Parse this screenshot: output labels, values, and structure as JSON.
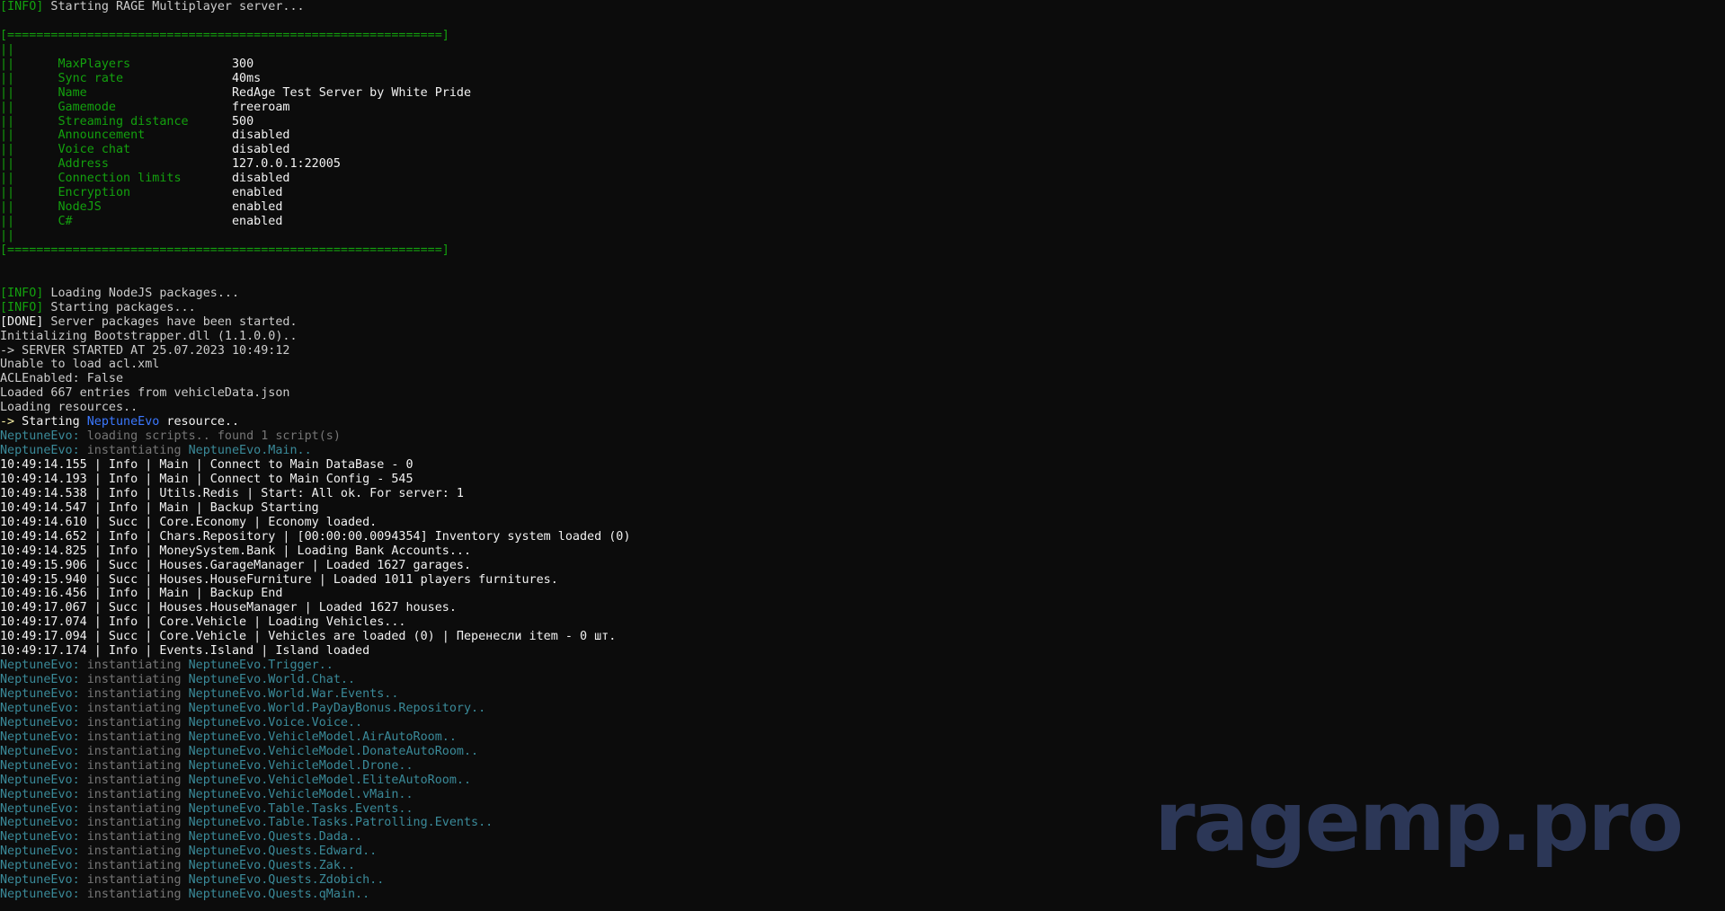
{
  "colors": {
    "default": "#cccccc",
    "green": "#13a10e",
    "bright_green": "#16c60c",
    "white": "#f2f2f2",
    "yellow": "#f9f1a5",
    "blue": "#3b78ff",
    "teal": "#3a96dd",
    "gray": "#767676",
    "dark_cyan": "#3a8a99",
    "watermark": "#2e3a5c",
    "background": "#0c0c0c"
  },
  "watermark": {
    "text": "ragemp.pro"
  },
  "console": {
    "lines": [
      [
        {
          "c": "green",
          "t": "[INFO]"
        },
        {
          "c": "default",
          "t": " Starting RAGE Multiplayer server..."
        }
      ],
      [],
      [
        {
          "c": "green",
          "t": "[============================================================]"
        }
      ],
      [
        {
          "c": "green",
          "t": "||"
        }
      ],
      [
        {
          "c": "green",
          "t": "||      MaxPlayers              "
        },
        {
          "c": "white",
          "t": "300"
        }
      ],
      [
        {
          "c": "green",
          "t": "||      Sync rate               "
        },
        {
          "c": "white",
          "t": "40ms"
        }
      ],
      [
        {
          "c": "green",
          "t": "||      Name                    "
        },
        {
          "c": "white",
          "t": "RedAge Test Server by White Pride"
        }
      ],
      [
        {
          "c": "green",
          "t": "||      Gamemode                "
        },
        {
          "c": "white",
          "t": "freeroam"
        }
      ],
      [
        {
          "c": "green",
          "t": "||      Streaming distance      "
        },
        {
          "c": "white",
          "t": "500"
        }
      ],
      [
        {
          "c": "green",
          "t": "||      Announcement            "
        },
        {
          "c": "white",
          "t": "disabled"
        }
      ],
      [
        {
          "c": "green",
          "t": "||      Voice chat              "
        },
        {
          "c": "white",
          "t": "disabled"
        }
      ],
      [
        {
          "c": "green",
          "t": "||      Address                 "
        },
        {
          "c": "white",
          "t": "127.0.0.1:22005"
        }
      ],
      [
        {
          "c": "green",
          "t": "||      Connection limits       "
        },
        {
          "c": "white",
          "t": "disabled"
        }
      ],
      [
        {
          "c": "green",
          "t": "||      Encryption              "
        },
        {
          "c": "white",
          "t": "enabled"
        }
      ],
      [
        {
          "c": "green",
          "t": "||      NodeJS                  "
        },
        {
          "c": "white",
          "t": "enabled"
        }
      ],
      [
        {
          "c": "green",
          "t": "||      C#                      "
        },
        {
          "c": "white",
          "t": "enabled"
        }
      ],
      [
        {
          "c": "green",
          "t": "||"
        }
      ],
      [
        {
          "c": "green",
          "t": "[============================================================]"
        }
      ],
      [],
      [],
      [
        {
          "c": "green",
          "t": "[INFO]"
        },
        {
          "c": "default",
          "t": " Loading NodeJS packages..."
        }
      ],
      [
        {
          "c": "green",
          "t": "[INFO]"
        },
        {
          "c": "default",
          "t": " Starting packages..."
        }
      ],
      [
        {
          "c": "white",
          "t": "[DONE]"
        },
        {
          "c": "default",
          "t": " Server packages have been started."
        }
      ],
      [
        {
          "c": "default",
          "t": "Initializing Bootstrapper.dll (1.1.0.0).."
        }
      ],
      [
        {
          "c": "default",
          "t": "-> SERVER STARTED AT 25.07.2023 10:49:12"
        }
      ],
      [
        {
          "c": "default",
          "t": "Unable to load acl.xml"
        }
      ],
      [
        {
          "c": "default",
          "t": "ACLEnabled: False"
        }
      ],
      [
        {
          "c": "default",
          "t": "Loaded 667 entries from vehicleData.json"
        }
      ],
      [
        {
          "c": "default",
          "t": "Loading resources.."
        }
      ],
      [
        {
          "c": "yellow",
          "t": "->"
        },
        {
          "c": "white",
          "t": " Starting "
        },
        {
          "c": "blue",
          "t": "NeptuneEvo"
        },
        {
          "c": "white",
          "t": " resource.."
        }
      ],
      [
        {
          "c": "dkcyan",
          "t": "NeptuneEvo: "
        },
        {
          "c": "gray",
          "t": "loading scripts.. found 1 script(s)"
        }
      ],
      [
        {
          "c": "dkcyan",
          "t": "NeptuneEvo: "
        },
        {
          "c": "gray",
          "t": "instantiating "
        },
        {
          "c": "dkcyan",
          "t": "NeptuneEvo.Main.."
        }
      ],
      [
        {
          "c": "white",
          "t": "10:49:14.155 | Info | Main | Connect to Main DataBase - 0"
        }
      ],
      [
        {
          "c": "white",
          "t": "10:49:14.193 | Info | Main | Connect to Main Config - 545"
        }
      ],
      [
        {
          "c": "white",
          "t": "10:49:14.538 | Info | Utils.Redis | Start: All ok. For server: 1"
        }
      ],
      [
        {
          "c": "white",
          "t": "10:49:14.547 | Info | Main | Backup Starting"
        }
      ],
      [
        {
          "c": "white",
          "t": "10:49:14.610 | Succ | Core.Economy | Economy loaded."
        }
      ],
      [
        {
          "c": "white",
          "t": "10:49:14.652 | Info | Chars.Repository | [00:00:00.0094354] Inventory system loaded (0)"
        }
      ],
      [
        {
          "c": "white",
          "t": "10:49:14.825 | Info | MoneySystem.Bank | Loading Bank Accounts..."
        }
      ],
      [
        {
          "c": "white",
          "t": "10:49:15.906 | Succ | Houses.GarageManager | Loaded 1627 garages."
        }
      ],
      [
        {
          "c": "white",
          "t": "10:49:15.940 | Succ | Houses.HouseFurniture | Loaded 1011 players furnitures."
        }
      ],
      [
        {
          "c": "white",
          "t": "10:49:16.456 | Info | Main | Backup End"
        }
      ],
      [
        {
          "c": "white",
          "t": "10:49:17.067 | Succ | Houses.HouseManager | Loaded 1627 houses."
        }
      ],
      [
        {
          "c": "white",
          "t": "10:49:17.074 | Info | Core.Vehicle | Loading Vehicles..."
        }
      ],
      [
        {
          "c": "white",
          "t": "10:49:17.094 | Succ | Core.Vehicle | Vehicles are loaded (0) | Перенесли item - 0 шт."
        }
      ],
      [
        {
          "c": "white",
          "t": "10:49:17.174 | Info | Events.Island | Island loaded"
        }
      ],
      [
        {
          "c": "dkcyan",
          "t": "NeptuneEvo: "
        },
        {
          "c": "gray",
          "t": "instantiating "
        },
        {
          "c": "dkcyan",
          "t": "NeptuneEvo.Trigger.."
        }
      ],
      [
        {
          "c": "dkcyan",
          "t": "NeptuneEvo: "
        },
        {
          "c": "gray",
          "t": "instantiating "
        },
        {
          "c": "dkcyan",
          "t": "NeptuneEvo.World.Chat.."
        }
      ],
      [
        {
          "c": "dkcyan",
          "t": "NeptuneEvo: "
        },
        {
          "c": "gray",
          "t": "instantiating "
        },
        {
          "c": "dkcyan",
          "t": "NeptuneEvo.World.War.Events.."
        }
      ],
      [
        {
          "c": "dkcyan",
          "t": "NeptuneEvo: "
        },
        {
          "c": "gray",
          "t": "instantiating "
        },
        {
          "c": "dkcyan",
          "t": "NeptuneEvo.World.PayDayBonus.Repository.."
        }
      ],
      [
        {
          "c": "dkcyan",
          "t": "NeptuneEvo: "
        },
        {
          "c": "gray",
          "t": "instantiating "
        },
        {
          "c": "dkcyan",
          "t": "NeptuneEvo.Voice.Voice.."
        }
      ],
      [
        {
          "c": "dkcyan",
          "t": "NeptuneEvo: "
        },
        {
          "c": "gray",
          "t": "instantiating "
        },
        {
          "c": "dkcyan",
          "t": "NeptuneEvo.VehicleModel.AirAutoRoom.."
        }
      ],
      [
        {
          "c": "dkcyan",
          "t": "NeptuneEvo: "
        },
        {
          "c": "gray",
          "t": "instantiating "
        },
        {
          "c": "dkcyan",
          "t": "NeptuneEvo.VehicleModel.DonateAutoRoom.."
        }
      ],
      [
        {
          "c": "dkcyan",
          "t": "NeptuneEvo: "
        },
        {
          "c": "gray",
          "t": "instantiating "
        },
        {
          "c": "dkcyan",
          "t": "NeptuneEvo.VehicleModel.Drone.."
        }
      ],
      [
        {
          "c": "dkcyan",
          "t": "NeptuneEvo: "
        },
        {
          "c": "gray",
          "t": "instantiating "
        },
        {
          "c": "dkcyan",
          "t": "NeptuneEvo.VehicleModel.EliteAutoRoom.."
        }
      ],
      [
        {
          "c": "dkcyan",
          "t": "NeptuneEvo: "
        },
        {
          "c": "gray",
          "t": "instantiating "
        },
        {
          "c": "dkcyan",
          "t": "NeptuneEvo.VehicleModel.vMain.."
        }
      ],
      [
        {
          "c": "dkcyan",
          "t": "NeptuneEvo: "
        },
        {
          "c": "gray",
          "t": "instantiating "
        },
        {
          "c": "dkcyan",
          "t": "NeptuneEvo.Table.Tasks.Events.."
        }
      ],
      [
        {
          "c": "dkcyan",
          "t": "NeptuneEvo: "
        },
        {
          "c": "gray",
          "t": "instantiating "
        },
        {
          "c": "dkcyan",
          "t": "NeptuneEvo.Table.Tasks.Patrolling.Events.."
        }
      ],
      [
        {
          "c": "dkcyan",
          "t": "NeptuneEvo: "
        },
        {
          "c": "gray",
          "t": "instantiating "
        },
        {
          "c": "dkcyan",
          "t": "NeptuneEvo.Quests.Dada.."
        }
      ],
      [
        {
          "c": "dkcyan",
          "t": "NeptuneEvo: "
        },
        {
          "c": "gray",
          "t": "instantiating "
        },
        {
          "c": "dkcyan",
          "t": "NeptuneEvo.Quests.Edward.."
        }
      ],
      [
        {
          "c": "dkcyan",
          "t": "NeptuneEvo: "
        },
        {
          "c": "gray",
          "t": "instantiating "
        },
        {
          "c": "dkcyan",
          "t": "NeptuneEvo.Quests.Zak.."
        }
      ],
      [
        {
          "c": "dkcyan",
          "t": "NeptuneEvo: "
        },
        {
          "c": "gray",
          "t": "instantiating "
        },
        {
          "c": "dkcyan",
          "t": "NeptuneEvo.Quests.Zdobich.."
        }
      ],
      [
        {
          "c": "dkcyan",
          "t": "NeptuneEvo: "
        },
        {
          "c": "gray",
          "t": "instantiating "
        },
        {
          "c": "dkcyan",
          "t": "NeptuneEvo.Quests.qMain.."
        }
      ]
    ]
  }
}
